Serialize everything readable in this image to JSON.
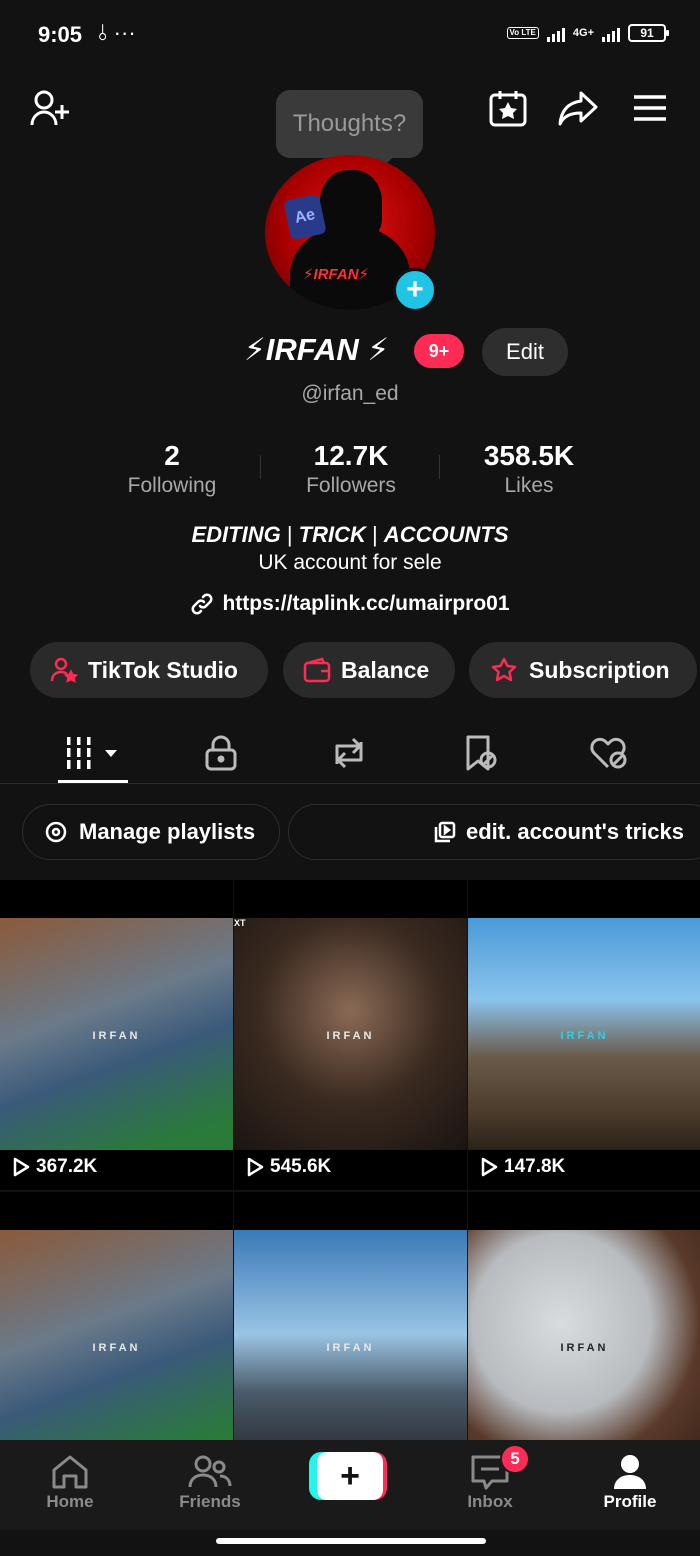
{
  "status_bar": {
    "time": "9:05",
    "left_icons": "⫰ ···",
    "volte": "Vo LTE",
    "network": "4G+",
    "battery": "91"
  },
  "header": {
    "tooltip": "Thoughts?",
    "icons": [
      "add-friend-icon",
      "calendar-star-icon",
      "share-icon",
      "menu-icon"
    ]
  },
  "profile": {
    "display_name": "⚡IRFAN ⚡",
    "notification_badge": "9+",
    "edit_label": "Edit",
    "username": "@irfan_ed",
    "avatar_text": "⚡IRFAN⚡",
    "avatar_logo": "Ae"
  },
  "stats": [
    {
      "value": "2",
      "label": "Following"
    },
    {
      "value": "12.7K",
      "label": "Followers"
    },
    {
      "value": "358.5K",
      "label": "Likes"
    }
  ],
  "bio": {
    "line1_parts": [
      "EDITING",
      " | ",
      "TRICK",
      " | ",
      "ACCOUNTS"
    ],
    "line2": "UK account for sele",
    "link": "https://taplink.cc/umairpro01"
  },
  "actions": [
    {
      "label": "TikTok Studio",
      "icon": "studio-person-icon"
    },
    {
      "label": "Balance",
      "icon": "wallet-icon"
    },
    {
      "label": "Subscription",
      "icon": "subscription-star-icon"
    }
  ],
  "tabs": [
    "videos-grid-icon",
    "private-lock-icon",
    "reposts-icon",
    "favorites-bookmark-icon",
    "liked-heart-icon"
  ],
  "playlists": {
    "manage_label": "Manage playlists",
    "playlist_label": "edit. account's tricks"
  },
  "videos": [
    {
      "views": "367.2K",
      "watermark": "IRFAN",
      "overlay": ""
    },
    {
      "views": "545.6K",
      "watermark": "IRFAN",
      "overlay": "XT"
    },
    {
      "views": "147.8K",
      "watermark": "IRFAN",
      "overlay": ""
    },
    {
      "views": "",
      "watermark": "IRFAN",
      "overlay": ""
    },
    {
      "views": "",
      "watermark": "IRFAN",
      "overlay": ""
    },
    {
      "views": "",
      "watermark": "IRFAN",
      "overlay": ""
    }
  ],
  "nav": {
    "home": "Home",
    "friends": "Friends",
    "create": "+",
    "inbox": "Inbox",
    "inbox_badge": "5",
    "profile": "Profile"
  },
  "colors": {
    "background": "#121212",
    "accent": "#fe2c55",
    "cyan": "#20c4e4"
  }
}
